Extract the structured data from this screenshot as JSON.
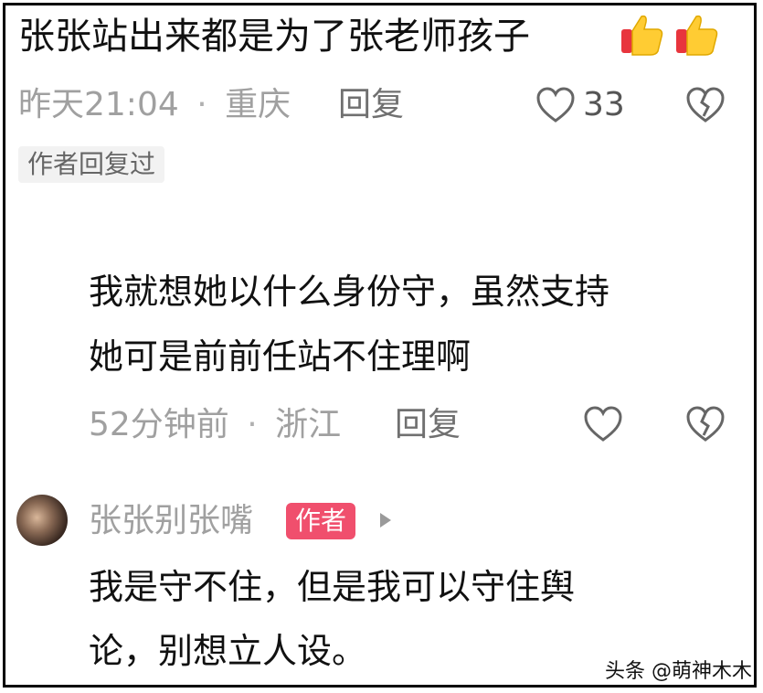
{
  "top_comment": {
    "text": "张张站出来都是为了张老师孩子",
    "emoji": [
      "👍",
      "👍"
    ],
    "time": "昨天21:04",
    "sep": "·",
    "location": "重庆",
    "reply_label": "回复",
    "likes": "33",
    "author_replied_tag": "作者回复过"
  },
  "reply_1": {
    "text_line1": "我就想她以什么身份守，虽然支持",
    "text_line2": "她可是前前任站不住理啊",
    "time": "52分钟前",
    "sep": "·",
    "location": "浙江",
    "reply_label": "回复"
  },
  "reply_2": {
    "username": "张张别张嘴",
    "author_badge": "作者",
    "text_line1": "我是守不住，但是我可以守住舆",
    "text_line2": "论，别想立人设。"
  },
  "watermark": "头条 @萌神木木"
}
